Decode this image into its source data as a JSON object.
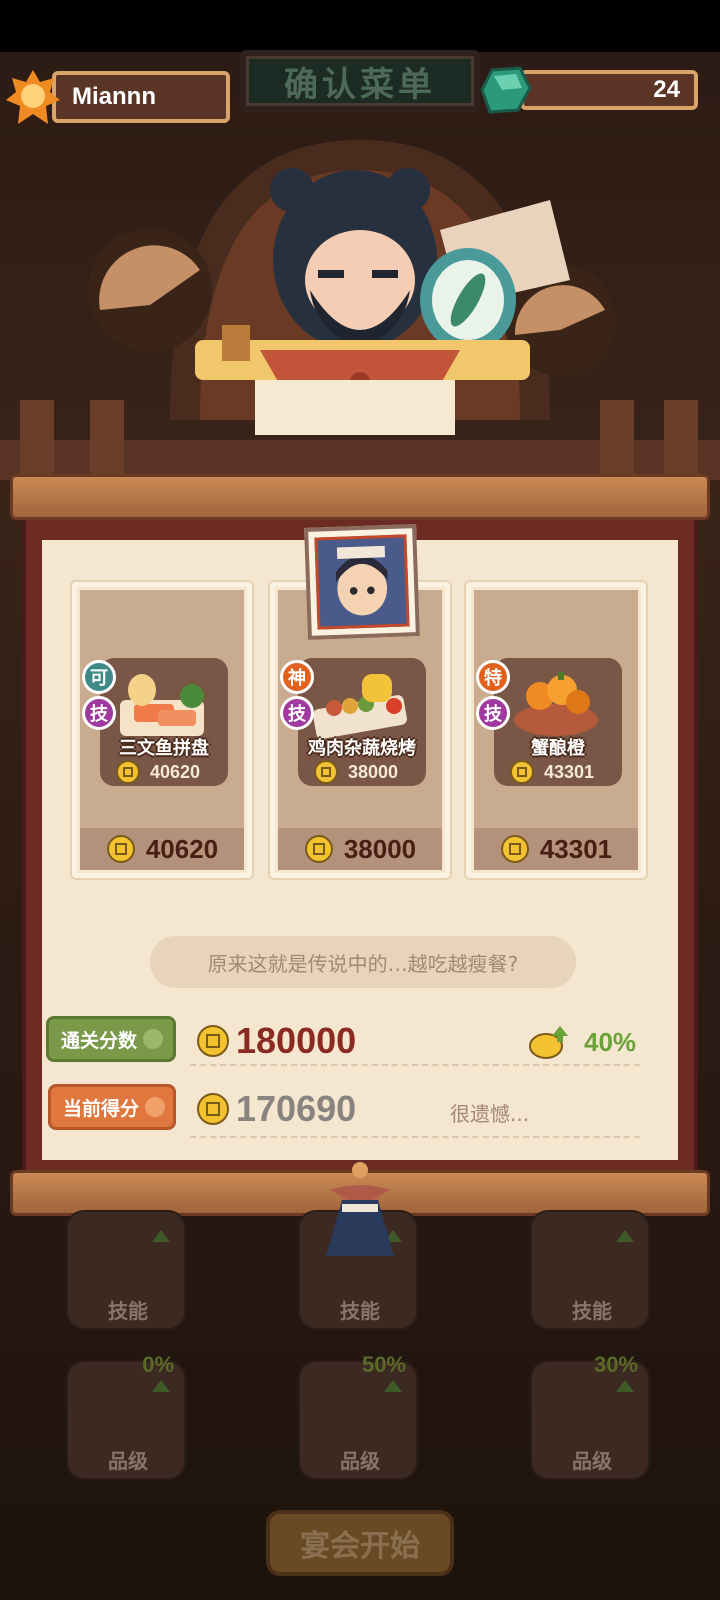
{
  "header": {
    "title": "确认菜单"
  },
  "player": {
    "name": "Miannn"
  },
  "currency": {
    "gems": "24"
  },
  "dishes": [
    {
      "badge1": "可",
      "badge2": "技",
      "name": "三文鱼拼盘",
      "price": "40620",
      "total": "40620",
      "badge1_color": "#3d8a86"
    },
    {
      "badge1": "神",
      "badge2": "技",
      "name": "鸡肉杂蔬烧烤",
      "price": "38000",
      "total": "38000",
      "badge1_color": "#e0621e"
    },
    {
      "badge1": "特",
      "badge2": "技",
      "name": "蟹酿橙",
      "price": "43301",
      "total": "43301",
      "badge1_color": "#e0621e"
    }
  ],
  "quote": "原来这就是传说中的…越吃越瘦餐?",
  "scores": {
    "target_label": "通关分数",
    "target_value": "180000",
    "bonus_pct": "40%",
    "current_label": "当前得分",
    "current_value": "170690",
    "result_text": "很遗憾..."
  },
  "slots": {
    "row1": [
      {
        "label": "技能"
      },
      {
        "label": "技能"
      },
      {
        "label": "技能"
      }
    ],
    "row2": [
      {
        "label": "品级",
        "pct": "0%"
      },
      {
        "label": "品级",
        "pct": "50%"
      },
      {
        "label": "品级",
        "pct": "30%"
      }
    ]
  },
  "start_button": "宴会开始",
  "colors": {
    "gold": "#f2c230",
    "dark_red": "#6b2a22",
    "green": "#6aa23a"
  }
}
